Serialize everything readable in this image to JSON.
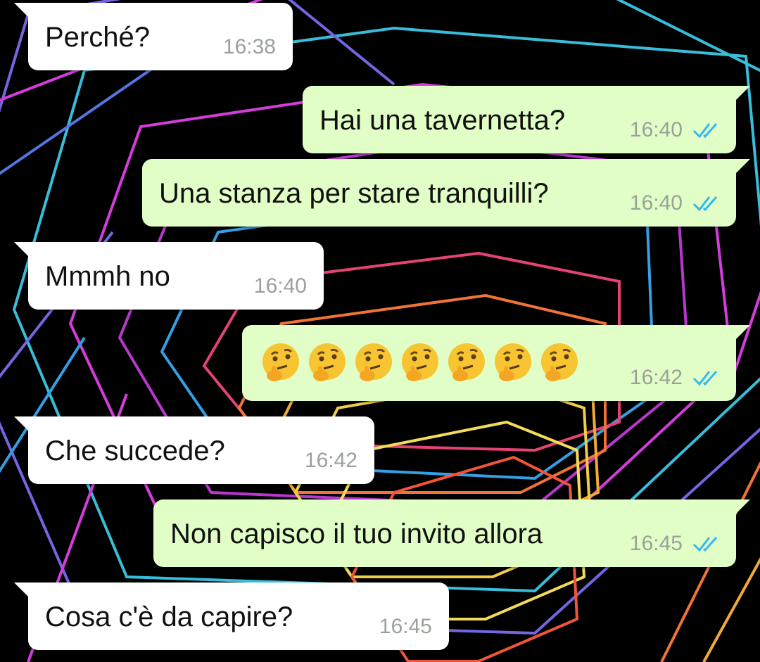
{
  "colors": {
    "incoming_bubble": "#ffffff",
    "outgoing_bubble": "#e1fec6",
    "read_ticks": "#34b7f1",
    "timestamp": "#9aa19a"
  },
  "messages": [
    {
      "direction": "in",
      "text": "Perché?",
      "time": "16:38"
    },
    {
      "direction": "out",
      "text": "Hai una tavernetta?",
      "time": "16:40",
      "status": "read"
    },
    {
      "direction": "out",
      "text": "Una stanza per stare tranquilli?",
      "time": "16:40",
      "status": "read"
    },
    {
      "direction": "in",
      "text": "Mmmh no",
      "time": "16:40"
    },
    {
      "direction": "out",
      "text": "🤔🤔🤔🤔🤔🤔🤔",
      "emoji": "thinking-face",
      "emoji_count": 7,
      "time": "16:42",
      "status": "read"
    },
    {
      "direction": "in",
      "text": "Che succede?",
      "time": "16:42"
    },
    {
      "direction": "out",
      "text": "Non capisco il tuo invito allora",
      "time": "16:45",
      "status": "read"
    },
    {
      "direction": "in",
      "text": "Cosa c'è da capire?",
      "time": "16:45"
    }
  ]
}
